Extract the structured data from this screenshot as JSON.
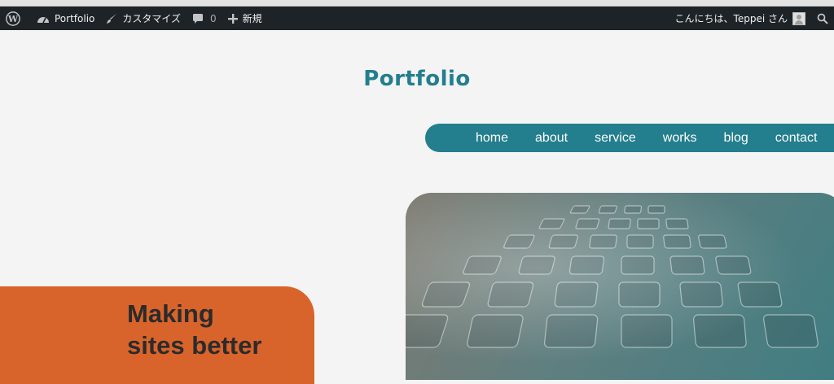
{
  "admin_bar": {
    "wp_logo_icon": "wordpress-icon",
    "site_name": "Portfolio",
    "customize_label": "カスタマイズ",
    "comments_count": "0",
    "new_label": "新規",
    "greeting": "こんにちは、Teppei さん"
  },
  "site": {
    "title": "Portfolio"
  },
  "nav": {
    "items": [
      "home",
      "about",
      "service",
      "works",
      "blog",
      "contact"
    ]
  },
  "hero": {
    "headline_line1": "Making",
    "headline_line2": "sites better",
    "image_alt_icon": "keyboard-photo"
  },
  "colors": {
    "accent_teal": "#237e8d",
    "accent_orange": "#d9642b",
    "admin_bar_bg": "#1d2327"
  }
}
